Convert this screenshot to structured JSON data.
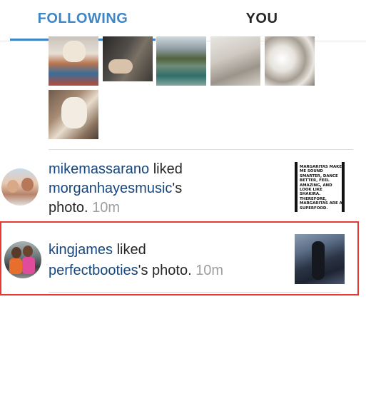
{
  "tabs": {
    "following_label": "FOLLOWING",
    "you_label": "YOU",
    "active": "FOLLOWING"
  },
  "colors": {
    "accent": "#3f86c6",
    "username": "#15467e",
    "timestamp": "#9e9e9e",
    "highlight": "#e53935"
  },
  "notifications": [
    {
      "user": "mikemassarano",
      "action": "liked",
      "owner": "morganhayesmusic",
      "owner_suffix": "'s",
      "object": "photo.",
      "time": "10m",
      "post_text": "MARGARITAS MAKE ME SOUND SMARTER, DANCE BETTER, FEEL AMAZING, AND LOOK LIKE SHAKIRA. THEREFORE, MARGARITAS ARE A SUPERFOOD."
    },
    {
      "user": "kingjames",
      "action": "liked",
      "owner": "perfectbooties",
      "owner_suffix": "'s photo.",
      "time": "10m",
      "highlighted": true
    }
  ]
}
